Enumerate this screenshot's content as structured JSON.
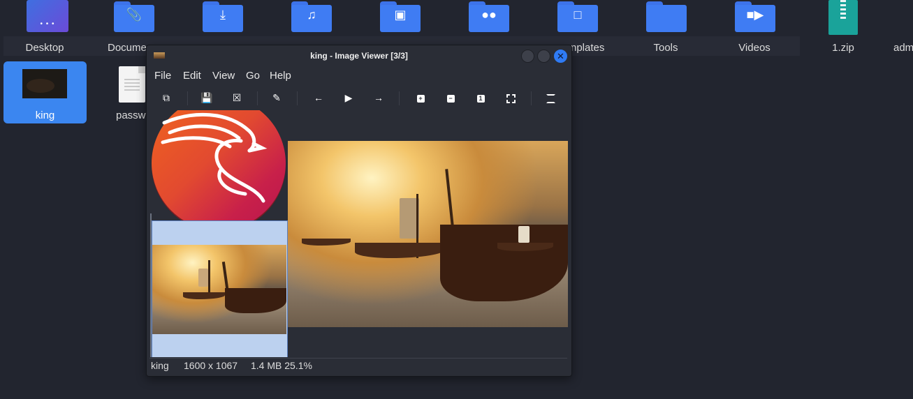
{
  "desktop": {
    "icons": [
      {
        "label": "Desktop",
        "icon": "desktop-folder-icon"
      },
      {
        "label": "Docume",
        "icon": "documents-folder-icon"
      },
      {
        "label": "",
        "icon": "downloads-folder-icon"
      },
      {
        "label": "",
        "icon": "music-folder-icon"
      },
      {
        "label": "",
        "icon": "pictures-folder-icon"
      },
      {
        "label": "",
        "icon": "public-folder-icon"
      },
      {
        "label": "nplates",
        "icon": "templates-folder-icon"
      },
      {
        "label": "Tools",
        "icon": "folder-icon"
      },
      {
        "label": "Videos",
        "icon": "videos-folder-icon"
      },
      {
        "label": "1.zip",
        "icon": "zip-archive-icon"
      },
      {
        "label": "adm",
        "icon": "folder-icon"
      }
    ],
    "row2": [
      {
        "label": "king",
        "selected": true
      },
      {
        "label": "passw"
      }
    ]
  },
  "window": {
    "title": "king - Image Viewer [3/3]",
    "close_glyph": "✕",
    "menu": [
      "File",
      "Edit",
      "View",
      "Go",
      "Help"
    ],
    "toolbar": [
      "open-icon",
      "save-icon",
      "delete-icon",
      "edit-icon",
      "back-arrow-icon",
      "play-icon",
      "forward-arrow-icon",
      "zoom-in-icon",
      "zoom-out-icon",
      "zoom-100-icon",
      "zoom-fit-icon",
      "fullscreen-icon"
    ],
    "toolbar_glyphs": {
      "zoom_100": "1"
    },
    "status": {
      "name": "king",
      "dimensions": "1600 x 1067",
      "size_zoom": "1.4 MB 25.1%"
    }
  },
  "colors": {
    "desktop_bg": "#22252f",
    "folder_blue": "#3f7cf3",
    "selection_blue": "#3b86f0",
    "window_bg": "#2a2d36",
    "zip_teal": "#1aa39a"
  }
}
